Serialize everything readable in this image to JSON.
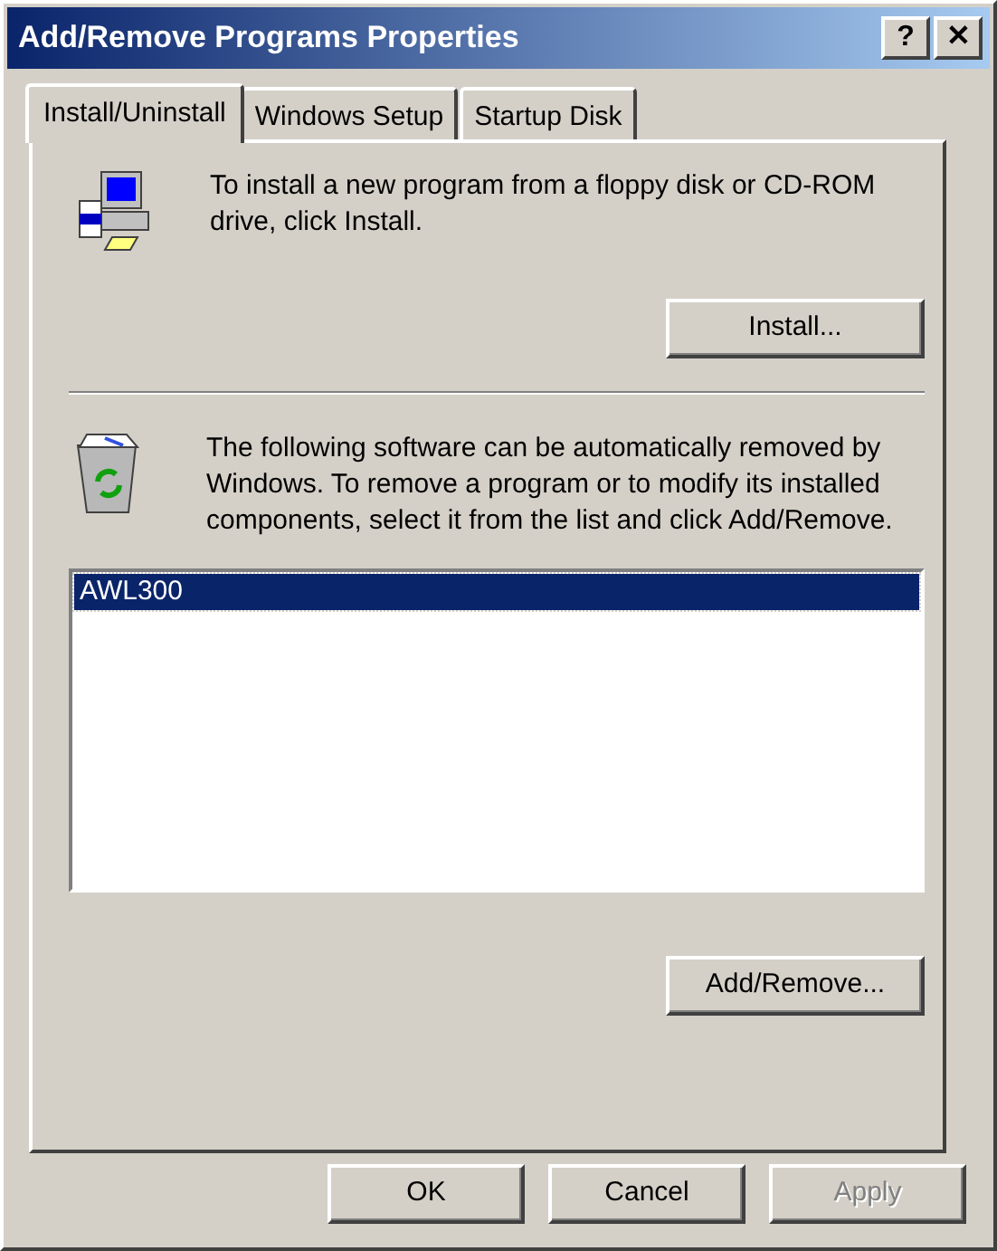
{
  "window": {
    "title": "Add/Remove Programs Properties",
    "title_buttons": [
      "?",
      "✕"
    ]
  },
  "tabs": [
    {
      "label": "Install/Uninstall",
      "selected": true
    },
    {
      "label": "Windows Setup",
      "selected": false
    },
    {
      "label": "Startup Disk",
      "selected": false
    }
  ],
  "install_section": {
    "text": "To install a new program from a floppy disk or CD-ROM drive, click Install.",
    "button": {
      "label": "Install..."
    }
  },
  "remove_section": {
    "text": "The following software can be automatically removed by Windows. To remove a program or to modify its installed components, select it from the list and click Add/Remove.",
    "programs": [
      {
        "name": "AWL300",
        "selected": true
      }
    ],
    "button": {
      "label": "Add/Remove..."
    }
  },
  "buttons": [
    {
      "label": "OK",
      "disabled": false
    },
    {
      "label": "Cancel",
      "disabled": false
    },
    {
      "label": "Apply",
      "disabled": true
    }
  ]
}
